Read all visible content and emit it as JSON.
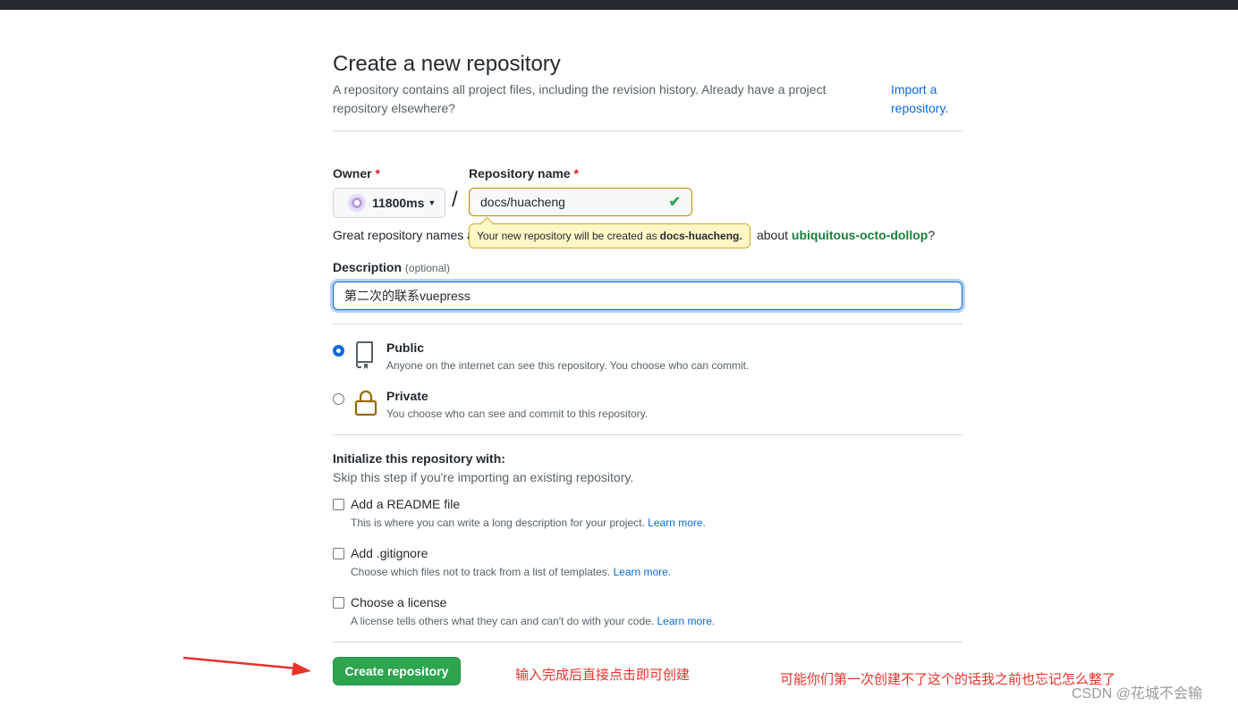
{
  "page": {
    "title": "Create a new repository",
    "subhead": "A repository contains all project files, including the revision history. Already have a project repository elsewhere?",
    "import_link": "Import a repository."
  },
  "owner": {
    "label": "Owner",
    "required_mark": "*",
    "value": "11800ms"
  },
  "repo_name": {
    "label": "Repository name",
    "required_mark": "*",
    "value": "docs/huacheng"
  },
  "great_names": {
    "prefix": "Great repository names a",
    "suffix": "about",
    "suggestion": "ubiquitous-octo-dollop",
    "qmark": "?"
  },
  "tooltip": {
    "text": "Your new repository will be created as",
    "name": "docs-huacheng."
  },
  "description": {
    "label": "Description",
    "optional": "(optional)",
    "value": "第二次的联系vuepress"
  },
  "visibility": {
    "public": {
      "title": "Public",
      "desc": "Anyone on the internet can see this repository. You choose who can commit.",
      "selected": true
    },
    "private": {
      "title": "Private",
      "desc": "You choose who can see and commit to this repository.",
      "selected": false
    }
  },
  "init": {
    "title": "Initialize this repository with:",
    "subtitle": "Skip this step if you're importing an existing repository.",
    "options": [
      {
        "title": "Add a README file",
        "desc": "This is where you can write a long description for your project.",
        "link": "Learn more.",
        "checked": false
      },
      {
        "title": "Add .gitignore",
        "desc": "Choose which files not to track from a list of templates.",
        "link": "Learn more.",
        "checked": false
      },
      {
        "title": "Choose a license",
        "desc": "A license tells others what they can and can't do with your code.",
        "link": "Learn more.",
        "checked": false
      }
    ]
  },
  "create_button": "Create repository",
  "annotations": {
    "note1": "输入完成后直接点击即可创建",
    "note2": "可能你们第一次创建不了这个的话我之前也忘记怎么整了",
    "watermark": "CSDN @花城不会输"
  },
  "colors": {
    "primary_button": "#2da44e",
    "link": "#0969da",
    "annotation_red": "#e8322a",
    "suggestion_green": "#1a7f37"
  }
}
